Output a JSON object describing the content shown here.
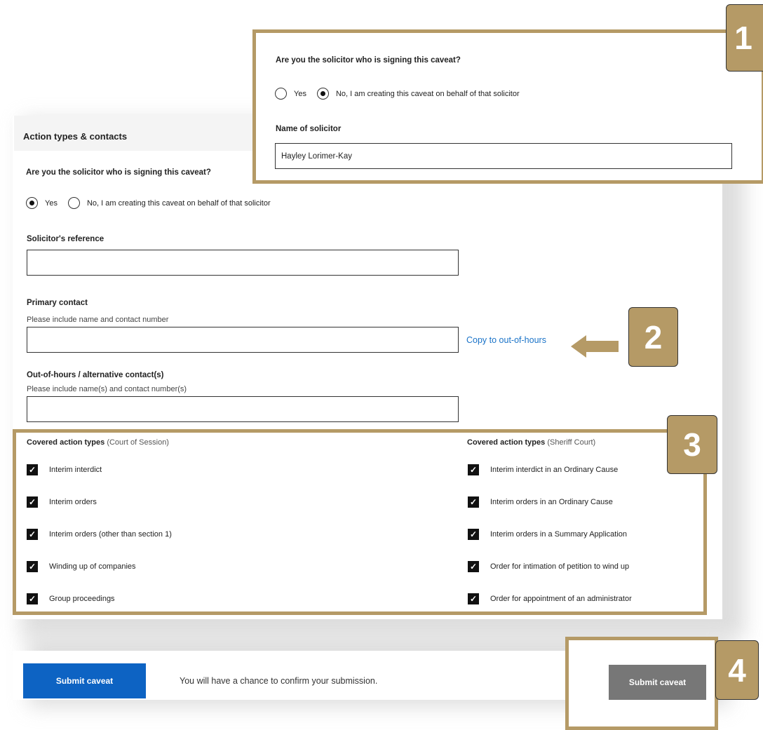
{
  "panel": {
    "title": "Action types & contacts",
    "solicitor_question": "Are you the solicitor who is signing this caveat?",
    "radio_yes": "Yes",
    "radio_no": "No, I am creating this caveat on behalf of that solicitor",
    "reference_label": "Solicitor's reference",
    "reference_value": "",
    "primary_label": "Primary contact",
    "primary_hint": "Please include name and contact number",
    "primary_value": "",
    "copy_link": "Copy to out-of-hours",
    "oohours_label": "Out-of-hours / alternative contact(s)",
    "oohours_hint": "Please include name(s) and contact number(s)",
    "oohours_value": ""
  },
  "action_types": {
    "session_title": "Covered action types",
    "session_sub": "(Court of Session)",
    "session_items": [
      "Interim interdict",
      "Interim orders",
      "Interim orders (other than section 1)",
      "Winding up of companies",
      "Group proceedings"
    ],
    "sheriff_title": "Covered action types",
    "sheriff_sub": "(Sheriff Court)",
    "sheriff_items": [
      "Interim interdict in an Ordinary Cause",
      "Interim orders in an Ordinary Cause",
      "Interim orders in a Summary Application",
      "Order for intimation of petition to wind up",
      "Order for appointment of an administrator"
    ],
    "checkmark": "✓"
  },
  "callout1": {
    "question": "Are you the solicitor who is signing this caveat?",
    "radio_yes": "Yes",
    "radio_no": "No, I am creating this caveat on behalf of that solicitor",
    "name_label": "Name of solicitor",
    "name_value": "Hayley Lorimer-Kay"
  },
  "bottom": {
    "submit_label": "Submit caveat",
    "note": "You will have a chance to confirm your submission.",
    "disabled_submit_label": "Submit caveat"
  },
  "badges": {
    "b1": "1",
    "b2": "2",
    "b3": "3",
    "b4": "4"
  },
  "colors": {
    "tan": "#b59a66",
    "primary": "#0d63c3",
    "link": "#1a73c8",
    "disabled": "#777777"
  }
}
